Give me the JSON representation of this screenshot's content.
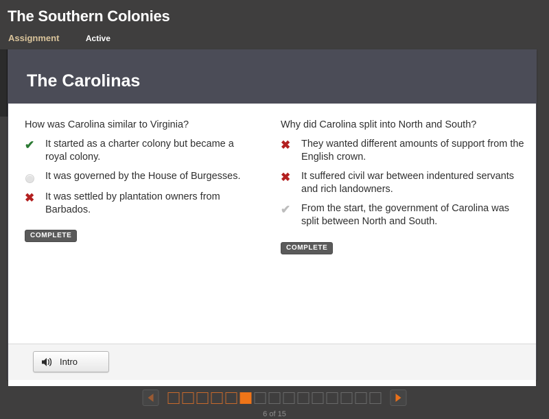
{
  "header": {
    "title": "The Southern Colonies",
    "kind_label": "Assignment",
    "state_label": "Active"
  },
  "slide": {
    "title": "The Carolinas",
    "columns": [
      {
        "question": "How was Carolina similar to Virginia?",
        "answers": [
          {
            "mark": "check-green-icon",
            "glyph": "✔",
            "text": "It started as a charter colony but became a royal colony."
          },
          {
            "mark": "empty-circle-icon",
            "glyph": "",
            "text": "It was governed by the House of Burgesses."
          },
          {
            "mark": "cross-red-icon",
            "glyph": "✖",
            "text": "It was settled by plantation owners from Barbados."
          }
        ],
        "status_badge": "COMPLETE"
      },
      {
        "question": "Why did Carolina split into North and South?",
        "answers": [
          {
            "mark": "cross-red-icon",
            "glyph": "✖",
            "text": "They wanted different amounts of support from the English crown."
          },
          {
            "mark": "cross-red-icon",
            "glyph": "✖",
            "text": "It suffered civil war between indentured servants and rich landowners."
          },
          {
            "mark": "check-gray-icon",
            "glyph": "✔",
            "text": "From the start, the government of Carolina was split between North and South."
          }
        ],
        "status_badge": "COMPLETE"
      }
    ]
  },
  "footer": {
    "audio_button_label": "Intro",
    "audio_icon": "speaker-icon"
  },
  "pager": {
    "prev_icon": "triangle-left-icon",
    "next_icon": "triangle-right-icon",
    "current": 6,
    "total": 15,
    "count_label": "6 of 15",
    "dot_states": [
      "visited",
      "visited",
      "visited",
      "visited",
      "visited",
      "current",
      "upcoming",
      "upcoming",
      "upcoming",
      "upcoming",
      "upcoming",
      "upcoming",
      "upcoming",
      "upcoming",
      "upcoming"
    ]
  },
  "colors": {
    "page_background": "#3f3e3e",
    "slide_header": "#4b4c57",
    "accent_orange": "#ef7518",
    "correct_green": "#2b7a33",
    "wrong_red": "#b32020",
    "kind_label": "#d9c39a"
  }
}
